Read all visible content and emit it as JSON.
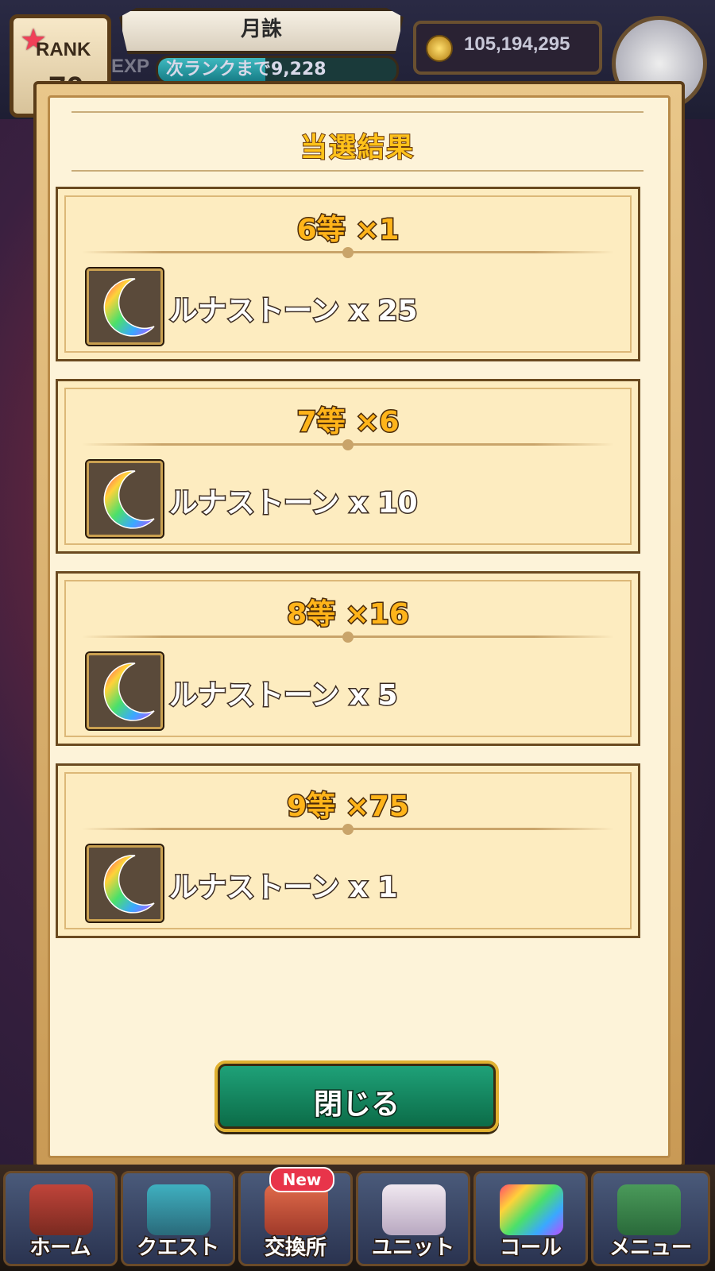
{
  "header": {
    "rank_label": "RANK",
    "rank_value": "70",
    "player_name": "月誅",
    "exp_label": "EXP",
    "exp_text": "次ランクまで9,228",
    "exp_progress": 0.45,
    "coins": "105,194,295"
  },
  "modal": {
    "title": "当選結果",
    "prizes": [
      {
        "tier": "6等 ×1",
        "item": "ルナストーン x 25",
        "icon": "luna-stone-icon"
      },
      {
        "tier": "7等 ×6",
        "item": "ルナストーン x 10",
        "icon": "luna-stone-icon"
      },
      {
        "tier": "8等 ×16",
        "item": "ルナストーン x 5",
        "icon": "luna-stone-icon"
      },
      {
        "tier": "9等 ×75",
        "item": "ルナストーン x 1",
        "icon": "luna-stone-icon"
      }
    ],
    "close_label": "閉じる"
  },
  "nav": {
    "items": [
      {
        "label": "ホーム",
        "icon": "home-icon"
      },
      {
        "label": "クエスト",
        "icon": "quest-icon"
      },
      {
        "label": "交換所",
        "icon": "exchange-icon",
        "badge": "New"
      },
      {
        "label": "ユニット",
        "icon": "unit-icon"
      },
      {
        "label": "コール",
        "icon": "call-icon"
      },
      {
        "label": "メニュー",
        "icon": "menu-book-icon"
      }
    ]
  },
  "colors": {
    "title_gold": "#ffc21a",
    "panel_bg": "#fdecc0",
    "button_green": "#0b6a46",
    "frame_brown": "#5a3c18"
  }
}
